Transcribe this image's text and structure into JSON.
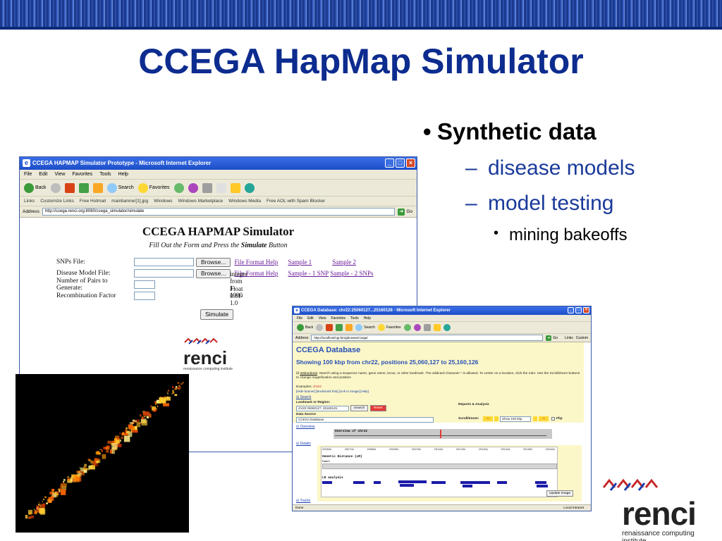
{
  "slide": {
    "title": "CCEGA HapMap Simulator",
    "bullets": {
      "b1": "Synthetic data",
      "b2": "disease models",
      "b3": "model testing",
      "b4": "mining bakeoffs"
    }
  },
  "ie1": {
    "window_title": "CCEGA HAPMAP Simulator Prototype - Microsoft Internet Explorer",
    "menu": [
      "File",
      "Edit",
      "View",
      "Favorites",
      "Tools",
      "Help"
    ],
    "toolbar": {
      "back": "Back",
      "search": "Search",
      "favorites": "Favorites"
    },
    "links_label": "Links",
    "links": [
      "Customize Links",
      "Free Hotmail",
      "mainbanner[1].jpg",
      "Windows",
      "Windows Marketplace",
      "Windows Media",
      "Free AOL with Spam Blocker"
    ],
    "address_label": "Address",
    "address": "http://ccega.renci.org:8080/ccega_simulator/simulate",
    "go": "Go",
    "page": {
      "title": "CCEGA HAPMAP Simulator",
      "subtitle_pre": "Fill Out the Form and Press the ",
      "subtitle_bold": "Simulate",
      "subtitle_post": " Button",
      "rows": {
        "snps_label": "SNPs File:",
        "disease_label": "Disease Model File:",
        "pairs_label": "Number of Pairs to Generate:",
        "recomb_label": "Recombination Factor",
        "browse": "Browse...",
        "file_format_help": "File Format Help",
        "sample1": "Sample 1",
        "sample2": "Sample 2",
        "sample_1snp": "Sample - 1 SNP",
        "sample_2snps": "Sample - 2 SNPs",
        "pairs_hint": "integer from 1-1000",
        "recomb_hint": "Float 0.01-1.0"
      },
      "simulate": "Simulate",
      "logo_word": "renci",
      "logo_sub": "renaissance computing institute"
    }
  },
  "ie2": {
    "window_title": "CCEGA Database: chr22:25060127...25160126 - Microsoft Internet Explorer",
    "menu": [
      "File",
      "Edit",
      "View",
      "Favorites",
      "Tools",
      "Help"
    ],
    "toolbar": {
      "back": "Back",
      "search": "Search",
      "favorites": "Favorites"
    },
    "address_label": "Address",
    "address": "http://localhost/cgi-bin/gbrowse/ccega/",
    "go": "Go",
    "links_label": "Links",
    "links_custom": "Custom",
    "db_title": "CCEGA Database",
    "showing": "Showing 100 kbp from chr22, positions 25,060,127 to 25,160,126",
    "instructions_label": "Instructions",
    "instructions": "Search using a sequence name, gene name, locus, or other landmark. The wildcard character * is allowed. To center on a location, click the ruler. Use the Scroll/Zoom buttons to change magnification and position",
    "examples_label": "Examples:",
    "examples_value": "chr22",
    "example_links": "[Hide banner] [Bookmark this] [Link to Image] [Help]",
    "search_section": "Search",
    "landmark_label": "Landmark or Region:",
    "landmark_value": "chr22:25060127..25160126",
    "search_btn": "Search",
    "reset_btn": "Reset",
    "reports_label": "Reports & Analysis",
    "datasource_label": "Data Source",
    "datasource_value": "CCEGA Database",
    "scrollzoom_label": "Scroll/Zoom:",
    "zoom_value": "Show 100 kbp",
    "flip_label": "Flip",
    "overview_section": "Overview",
    "overview_track": "Overview of chr22",
    "details_section": "Details",
    "ticks": [
      "25060k",
      "25070k",
      "25080k",
      "25090k",
      "25100k",
      "25110k",
      "25120k",
      "25130k",
      "25140k",
      "25150k",
      "25160k"
    ],
    "genetic_distance": "Genetic Distance (cM)",
    "rate": "Rate2",
    "ld_analysis": "LD analysis",
    "update_image": "Update Image",
    "tracks_section": "Tracks",
    "status_done": "Done",
    "status_zone": "Local intranet"
  },
  "logo": {
    "word": "renci",
    "sub": "renaissance computing institute"
  },
  "colors": {
    "title_blue": "#0d2c8f",
    "sub_bullet_blue": "#1a3a9a",
    "ie_titlebar": "#1d4ec9",
    "db_panel": "#fbf7c8",
    "link_purple": "#6a1b9a"
  }
}
